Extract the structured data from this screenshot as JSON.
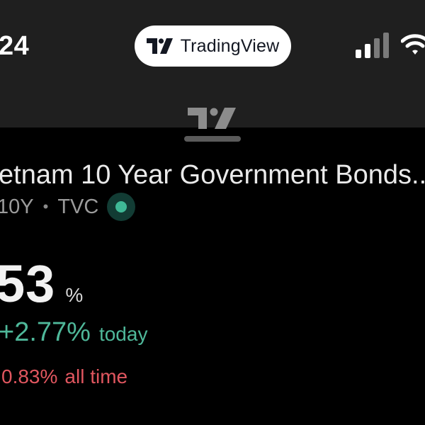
{
  "status_bar": {
    "time": "24",
    "signal_bars": 4,
    "signal_bars_active": 2,
    "app_pill": {
      "label": "TradingView",
      "logo_icon": "tradingview-logo-icon"
    },
    "wifi_icon": "wifi-icon",
    "signal_icon": "cellular-signal-icon"
  },
  "sheet": {
    "logo_icon": "tradingview-logo-icon",
    "grabber_icon": "sheet-grabber-icon"
  },
  "symbol": {
    "title": "etnam 10 Year Government Bonds...",
    "ticker": "10Y",
    "separator": "•",
    "exchange": "TVC",
    "live_status_icon": "market-open-dot-icon"
  },
  "quote": {
    "price": "53",
    "unit": "%",
    "change_today": "+2.77%",
    "change_today_label": "today",
    "change_all_time": "0.83%",
    "change_all_time_label": "all time"
  },
  "colors": {
    "background": "#000000",
    "status_bar_bg": "#1f1f1f",
    "positive": "#4fb89a",
    "negative": "#e0565f",
    "live_dot": "#3fb996"
  }
}
